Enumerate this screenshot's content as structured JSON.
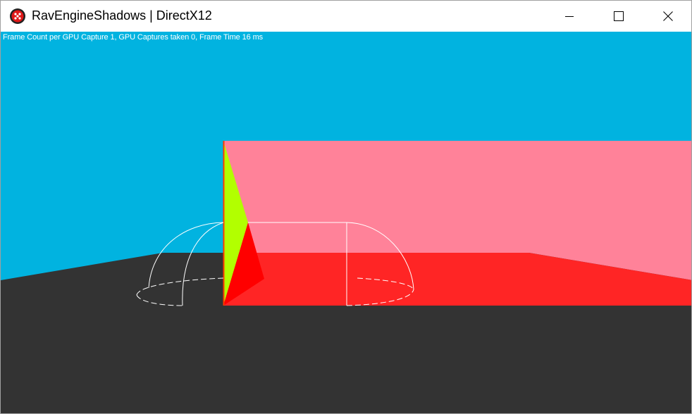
{
  "window": {
    "title": "RavEngineShadows | DirectX12",
    "app_icon": "red-dice-icon",
    "controls": {
      "minimize_icon": "minimize-icon",
      "maximize_icon": "maximize-icon",
      "close_icon": "close-icon"
    }
  },
  "viewport": {
    "overlay_text": "Frame Count per GPU Capture 1, GPU Captures taken 0, Frame Time 16 ms",
    "colors": {
      "sky": "#01b3e0",
      "floor": "#333333",
      "back_wall": "#ff8299",
      "red_floor": "#ff2525",
      "green_face": "#b2ff00",
      "red_face": "#ff0000",
      "wireframe": "#ffffff"
    }
  }
}
